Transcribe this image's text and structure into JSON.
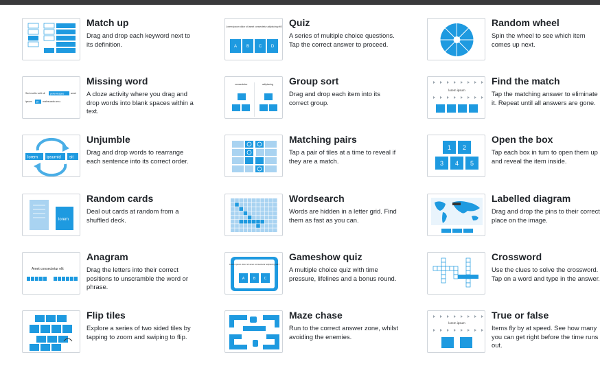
{
  "templates": [
    {
      "id": "match-up",
      "title": "Match up",
      "description": "Drag and drop each keyword next to its definition."
    },
    {
      "id": "quiz",
      "title": "Quiz",
      "description": "A series of multiple choice questions. Tap the correct answer to proceed."
    },
    {
      "id": "random-wheel",
      "title": "Random wheel",
      "description": "Spin the wheel to see which item comes up next."
    },
    {
      "id": "missing-word",
      "title": "Missing word",
      "description": "A cloze activity where you drag and drop words into blank spaces within a text."
    },
    {
      "id": "group-sort",
      "title": "Group sort",
      "description": "Drag and drop each item into its correct group."
    },
    {
      "id": "find-the-match",
      "title": "Find the match",
      "description": "Tap the matching answer to eliminate it. Repeat until all answers are gone."
    },
    {
      "id": "unjumble",
      "title": "Unjumble",
      "description": "Drag and drop words to rearrange each sentence into its correct order."
    },
    {
      "id": "matching-pairs",
      "title": "Matching pairs",
      "description": "Tap a pair of tiles at a time to reveal if they are a match."
    },
    {
      "id": "open-the-box",
      "title": "Open the box",
      "description": "Tap each box in turn to open them up and reveal the item inside."
    },
    {
      "id": "random-cards",
      "title": "Random cards",
      "description": "Deal out cards at random from a shuffled deck."
    },
    {
      "id": "wordsearch",
      "title": "Wordsearch",
      "description": "Words are hidden in a letter grid. Find them as fast as you can."
    },
    {
      "id": "labelled-diagram",
      "title": "Labelled diagram",
      "description": "Drag and drop the pins to their correct place on the image."
    },
    {
      "id": "anagram",
      "title": "Anagram",
      "description": "Drag the letters into their correct positions to unscramble the word or phrase."
    },
    {
      "id": "gameshow-quiz",
      "title": "Gameshow quiz",
      "description": "A multiple choice quiz with time pressure, lifelines and a bonus round."
    },
    {
      "id": "crossword",
      "title": "Crossword",
      "description": "Use the clues to solve the crossword. Tap on a word and type in the answer."
    },
    {
      "id": "flip-tiles",
      "title": "Flip tiles",
      "description": "Explore a series of two sided tiles by tapping to zoom and swiping to flip."
    },
    {
      "id": "maze-chase",
      "title": "Maze chase",
      "description": "Run to the correct answer zone, whilst avoiding the enemies."
    },
    {
      "id": "true-or-false",
      "title": "True or false",
      "description": "Items fly by at speed. See how many you can get right before the time runs out."
    }
  ],
  "thumb_text": {
    "quiz_question": "Lorem ipsum dolor sit amet consectetur adipiscing elit?",
    "quiz_options": [
      "A",
      "B",
      "C",
      "D"
    ],
    "missing_line1": "Sed mollis velit sit",
    "missing_word1": "pellentesque",
    "missing_line1_end": "amet",
    "missing_line2_start": "ipsum",
    "missing_word2": "sit",
    "missing_line2_end": "malesuada arcu.",
    "group_left": "consectetur",
    "group_right": "adipiscing",
    "unjumble_words": [
      "lorem",
      "ipsumid",
      "sit"
    ],
    "random_card_word": "lorem",
    "anagram_phrase": "Amet consectetur elit",
    "find_match_word": "lorem ipsum",
    "true_false_word": "lorem ipsum",
    "open_box_numbers": [
      "1",
      "2",
      "3",
      "4",
      "5"
    ]
  },
  "colors": {
    "accent": "#1e9ae0",
    "accent_light": "#a9d3f1",
    "border": "#cfd4da",
    "text": "#1f2328",
    "topbar": "#3a3a3c"
  }
}
